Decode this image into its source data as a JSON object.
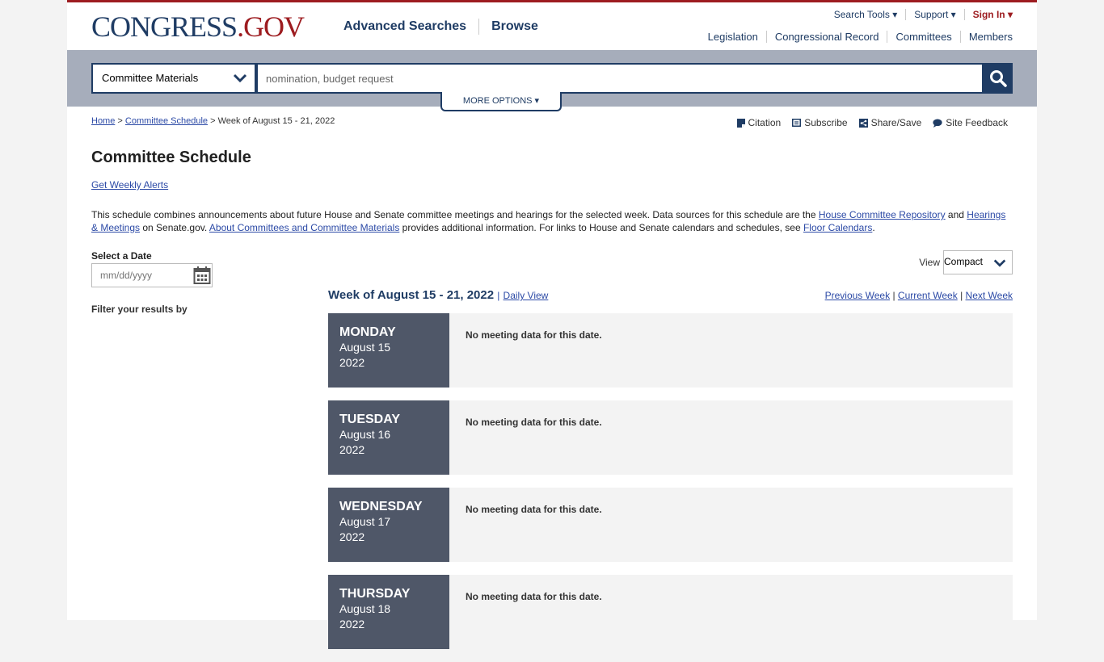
{
  "header": {
    "logo_main": "CONGRESS",
    "logo_dot_gov": ".GOV",
    "nav": [
      "Advanced Searches",
      "Browse"
    ],
    "top_links": [
      "Search Tools ▾",
      "Support ▾",
      "Sign In ▾"
    ],
    "sec_links": [
      "Legislation",
      "Congressional Record",
      "Committees",
      "Members"
    ]
  },
  "search": {
    "scope": "Committee Materials",
    "placeholder": "nomination, budget request",
    "more_options": "MORE OPTIONS ▾"
  },
  "breadcrumb": {
    "home": "Home",
    "sep": ">",
    "schedule": "Committee Schedule",
    "current": "Week of August 15 - 21, 2022"
  },
  "tools": [
    "Citation",
    "Subscribe",
    "Share/Save",
    "Site Feedback"
  ],
  "page": {
    "title": "Committee Schedule",
    "alerts_link": "Get Weekly Alerts",
    "intro": {
      "p1": "This schedule combines announcements about future House and Senate committee meetings and hearings for the selected week. Data sources for this schedule are the ",
      "link1": "House Committee Repository",
      "p2": " and ",
      "link2": "Hearings & Meetings",
      "p3": " on Senate.gov. ",
      "link3": "About Committees and Committee Materials",
      "p4": " provides additional information. For links to House and Senate calendars and schedules, see ",
      "link4": "Floor Calendars",
      "p5": "."
    }
  },
  "sidebar": {
    "date_label": "Select a Date",
    "date_placeholder": "mm/dd/yyyy",
    "filter_label": "Filter your results by"
  },
  "view": {
    "label": "View",
    "selected": "Compact"
  },
  "week": {
    "heading": "Week of August 15 - 21, 2022",
    "divider": "|",
    "daily_view": "Daily View",
    "prev": "Previous Week",
    "current": "Current Week",
    "next": "Next Week"
  },
  "days": [
    {
      "name": "MONDAY",
      "date": "August 15",
      "year": "2022",
      "message": "No meeting data for this date."
    },
    {
      "name": "TUESDAY",
      "date": "August 16",
      "year": "2022",
      "message": "No meeting data for this date."
    },
    {
      "name": "WEDNESDAY",
      "date": "August 17",
      "year": "2022",
      "message": "No meeting data for this date."
    },
    {
      "name": "THURSDAY",
      "date": "August 18",
      "year": "2022",
      "message": "No meeting data for this date."
    }
  ],
  "colors": {
    "brand_navy": "#1f3c64",
    "brand_red": "#9d1c20",
    "day_label_bg": "#4f5768",
    "search_band": "#a6adbb"
  }
}
